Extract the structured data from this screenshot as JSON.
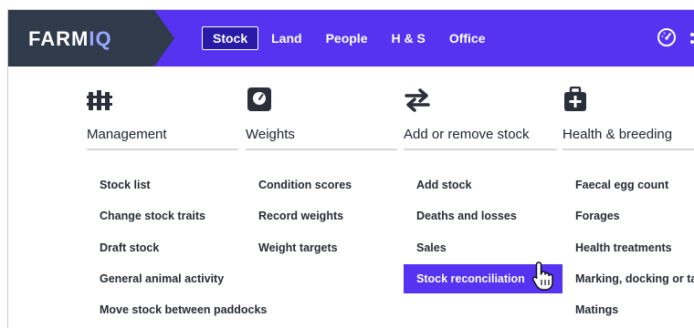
{
  "logo": {
    "text_main": "FARM",
    "text_accent": "IQ"
  },
  "nav": {
    "tabs": [
      "Stock",
      "Land",
      "People",
      "H & S",
      "Office"
    ],
    "active": "Stock"
  },
  "icons": {
    "header_right": [
      "dashboard-gauge-icon",
      "more-icon"
    ],
    "columns": [
      "fence-icon",
      "scale-icon",
      "swap-arrows-icon",
      "medical-bag-icon"
    ]
  },
  "colors": {
    "brand": "#5533f0",
    "logo_bg": "#2f3a4a",
    "active_tab": "#2a1aa8",
    "text": "#262c36",
    "divider": "#d6d6d6"
  },
  "menu": {
    "columns": [
      {
        "title": "Management",
        "items": [
          "Stock list",
          "Change stock traits",
          "Draft stock",
          "General animal activity",
          "Move stock between paddocks"
        ]
      },
      {
        "title": "Weights",
        "items": [
          "Condition scores",
          "Record weights",
          "Weight targets"
        ]
      },
      {
        "title": "Add or remove stock",
        "items": [
          "Add stock",
          "Deaths and losses",
          "Sales",
          "Stock reconciliation"
        ]
      },
      {
        "title": "Health & breeding",
        "items": [
          "Faecal egg count",
          "Forages",
          "Health treatments",
          "Marking, docking or ta",
          "Matings"
        ]
      }
    ],
    "highlighted_item": "Stock reconciliation"
  }
}
